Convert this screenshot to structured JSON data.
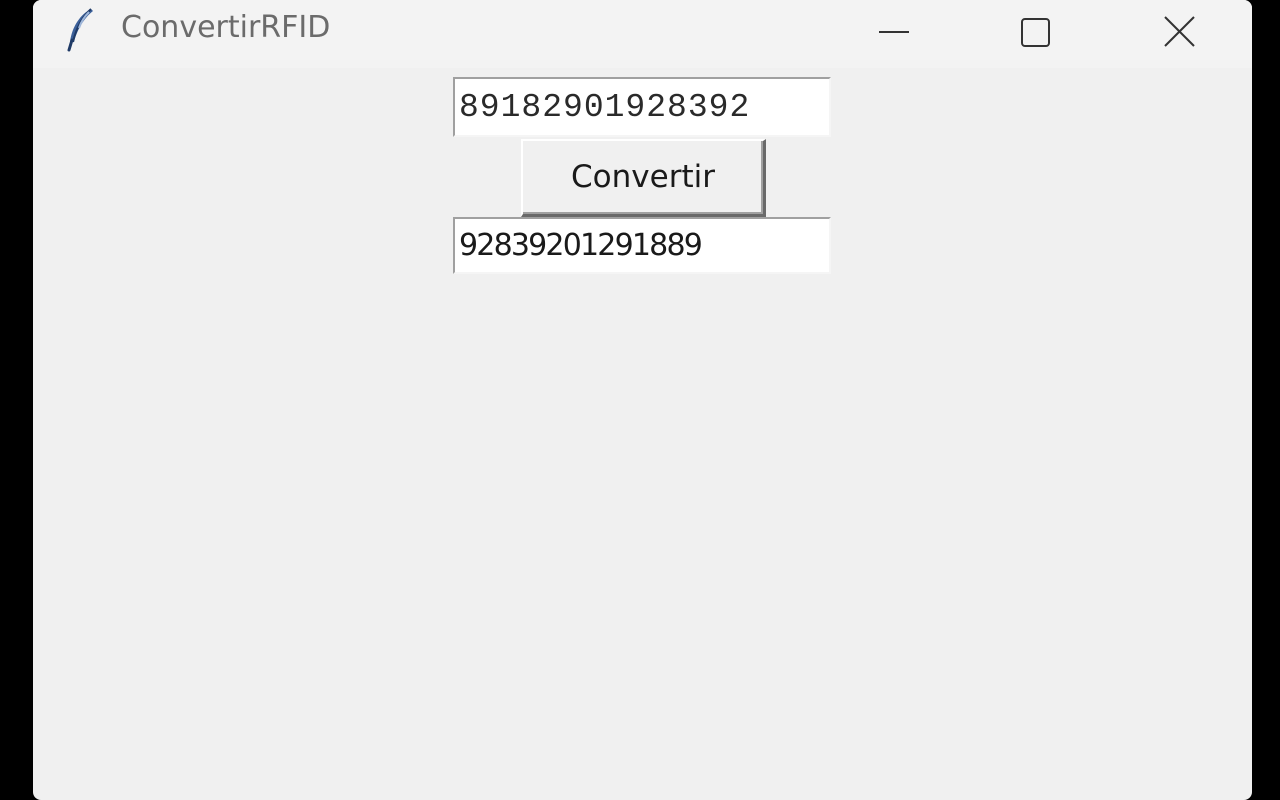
{
  "window": {
    "title": "ConvertirRFID",
    "icon": "feather-icon",
    "controls": [
      "minimize-icon",
      "maximize-icon",
      "close-icon"
    ]
  },
  "main": {
    "input_value": "89182901928392",
    "button_label": "Convertir",
    "output_value": "92839201291889"
  }
}
